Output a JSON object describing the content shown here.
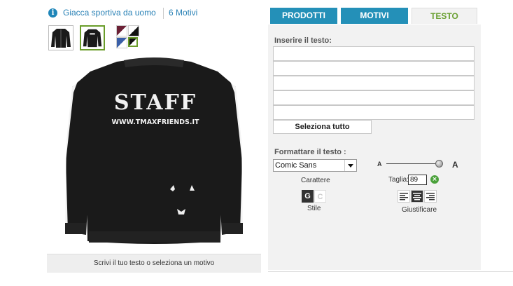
{
  "header": {
    "info_icon": "info-icon",
    "product_title": "Giacca sportiva da uomo",
    "motifs_count": "6 Motivi"
  },
  "thumbnails": [
    {
      "name": "jacket-front"
    },
    {
      "name": "jacket-back",
      "selected": true
    }
  ],
  "preview": {
    "print_title": "STAFF",
    "print_url": "WWW.TMAXFRIENDS.IT",
    "status_hint": "Scrivi il tuo testo o seleziona un motivo"
  },
  "tabs": [
    "PRODOTTI",
    "MOTIVI",
    "TESTO"
  ],
  "text_panel": {
    "input_heading": "Inserire il testo:",
    "select_all_label": "Seleziona tutto",
    "format_heading": "Formattare il testo :",
    "font_value": "Comic Sans",
    "font_caption": "Carattere",
    "size_small_glyph": "A",
    "size_large_glyph": "A",
    "size_label": "Taglia:",
    "size_value": "89",
    "bold_label": "G",
    "italic_label": "C",
    "style_caption": "Stile",
    "justify_caption": "Giustificare"
  },
  "colors": {
    "tab_blue": "#2490b8",
    "active_tab_text": "#6aa032",
    "link_blue": "#2a82b6",
    "jacket": "#1a1a1a"
  }
}
